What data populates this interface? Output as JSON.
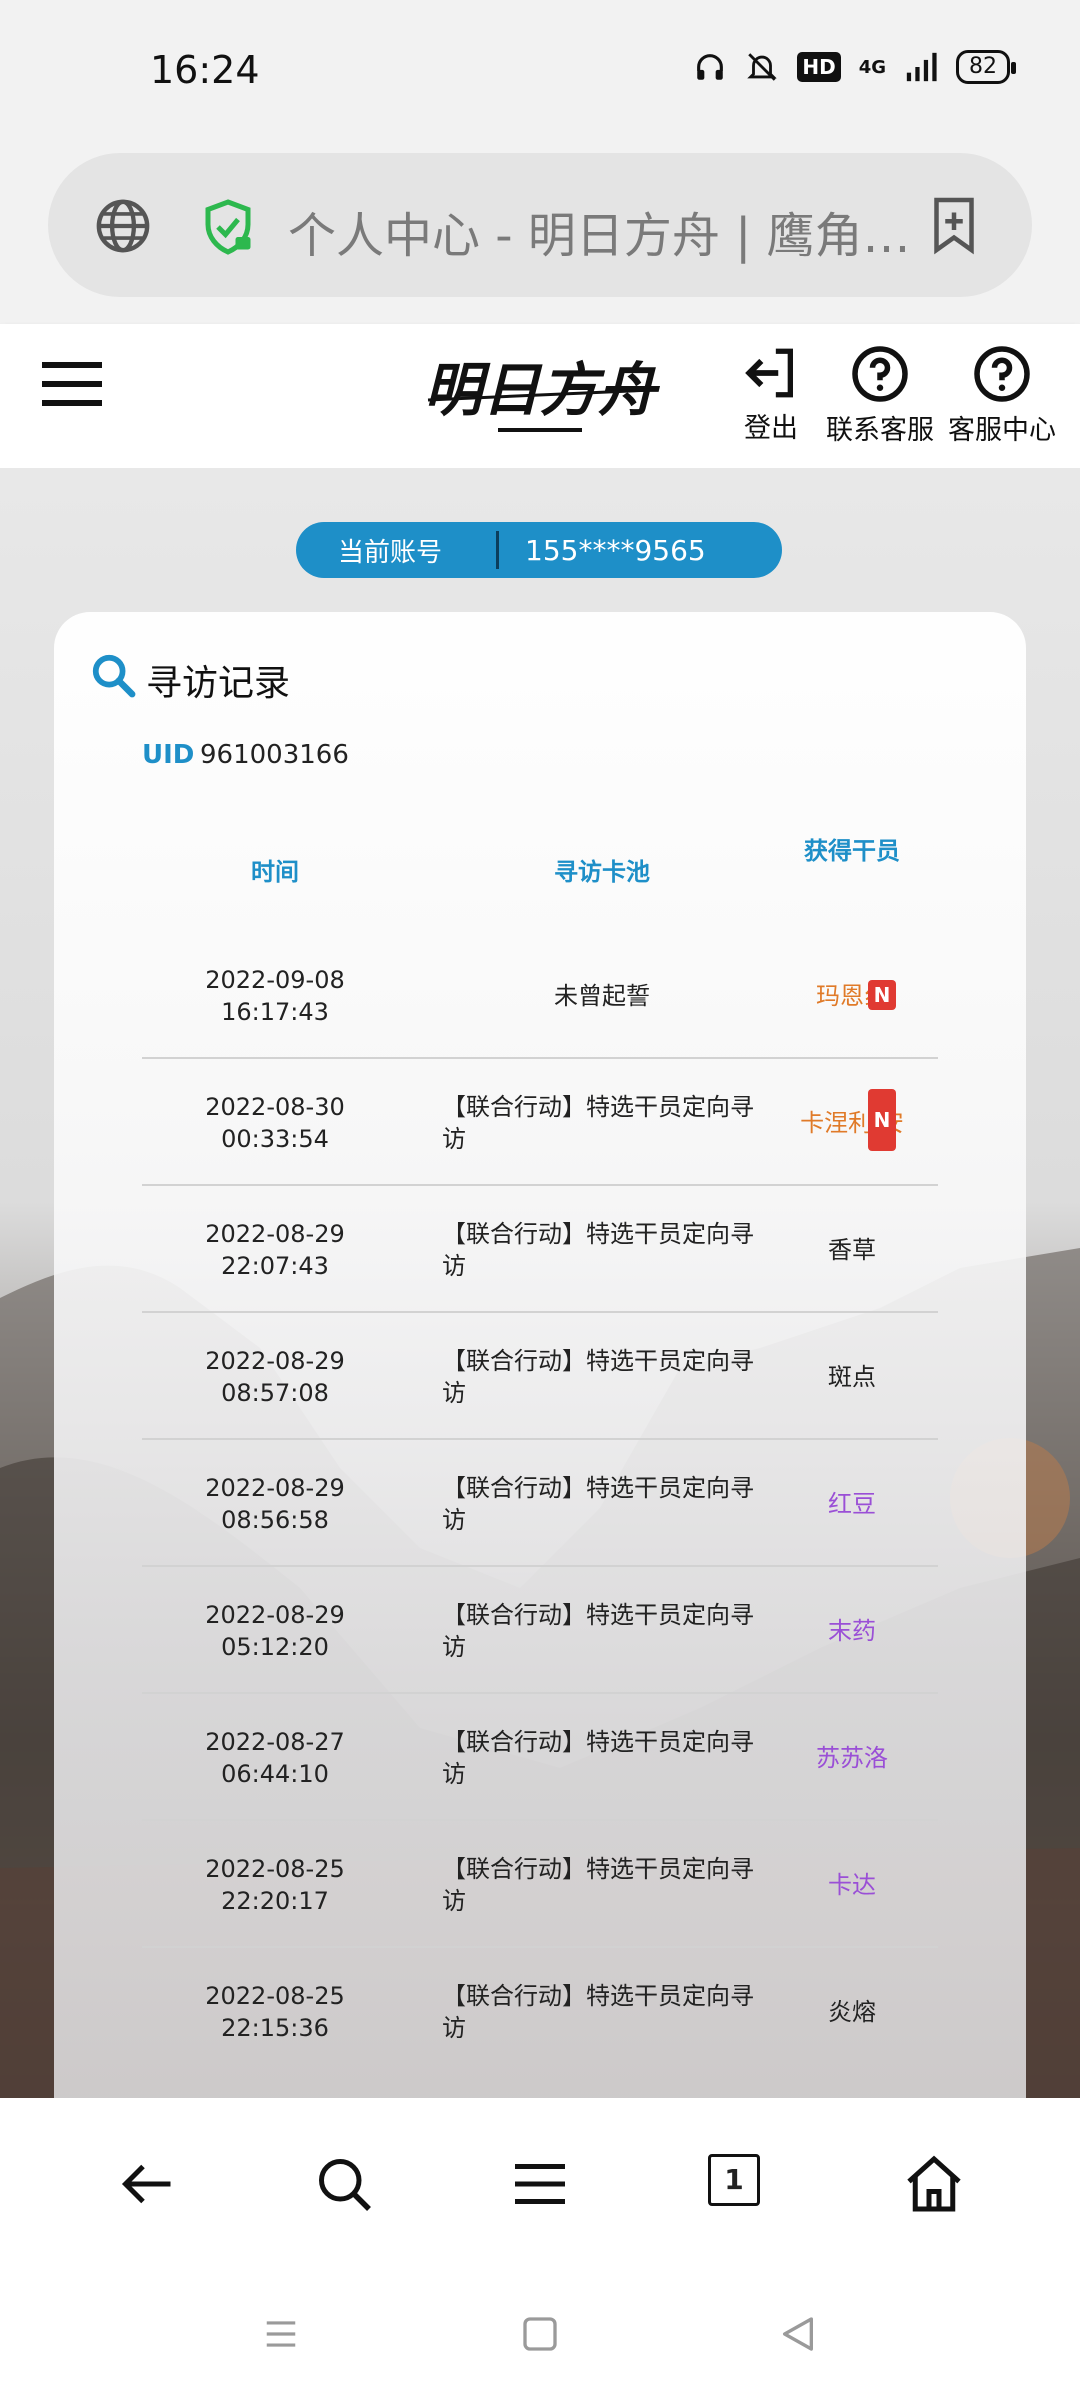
{
  "status_bar": {
    "time": "16:24",
    "network": "4G",
    "battery": "82"
  },
  "address_bar": {
    "title": "个人中心 - 明日方舟 | 鹰角…"
  },
  "header": {
    "logo_text": "明日方舟",
    "logout_label": "登出",
    "contact_label": "联系客服",
    "service_center_label": "客服中心"
  },
  "account": {
    "label": "当前账号",
    "value": "155****9565"
  },
  "records": {
    "heading": "寻访记录",
    "uid_label": "UID",
    "uid_value": "961003166",
    "columns": {
      "time": "时间",
      "pool": "寻访卡池",
      "operator": "获得干员"
    },
    "rows": [
      {
        "date": "2022-09-08",
        "time": "16:17:43",
        "pool": "未曾起誓",
        "operator": "玛恩纳",
        "operator_visible": "玛恩纟",
        "rarity_color": "#e07a28",
        "new": true,
        "new_label": "N"
      },
      {
        "date": "2022-08-30",
        "time": "00:33:54",
        "pool": "【联合行动】特选干员定向寻访",
        "operator": "卡涅利安",
        "operator_visible": "卡涅利 安",
        "rarity_color": "#e07a28",
        "new": true,
        "new_label": "N"
      },
      {
        "date": "2022-08-29",
        "time": "22:07:43",
        "pool": "【联合行动】特选干员定向寻访",
        "operator": "香草",
        "rarity_color": "#222222",
        "new": false
      },
      {
        "date": "2022-08-29",
        "time": "08:57:08",
        "pool": "【联合行动】特选干员定向寻访",
        "operator": "斑点",
        "rarity_color": "#222222",
        "new": false
      },
      {
        "date": "2022-08-29",
        "time": "08:56:58",
        "pool": "【联合行动】特选干员定向寻访",
        "operator": "红豆",
        "rarity_color": "#9a4fd6",
        "new": false
      },
      {
        "date": "2022-08-29",
        "time": "05:12:20",
        "pool": "【联合行动】特选干员定向寻访",
        "operator": "末药",
        "rarity_color": "#9a4fd6",
        "new": false
      },
      {
        "date": "2022-08-27",
        "time": "06:44:10",
        "pool": "【联合行动】特选干员定向寻访",
        "operator": "苏苏洛",
        "rarity_color": "#9a4fd6",
        "new": false
      },
      {
        "date": "2022-08-25",
        "time": "22:20:17",
        "pool": "【联合行动】特选干员定向寻访",
        "operator": "卡达",
        "rarity_color": "#9a4fd6",
        "new": false
      },
      {
        "date": "2022-08-25",
        "time": "22:15:36",
        "pool": "【联合行动】特选干员定向寻访",
        "operator": "炎熔",
        "rarity_color": "#222222",
        "new": false
      }
    ]
  },
  "colors": {
    "accent": "#1e8fc8",
    "six_star": "#e07a28",
    "four_star": "#9a4fd6",
    "new_badge": "#e03a32"
  },
  "toolbar_icons": [
    "back-icon",
    "search-icon",
    "menu-icon",
    "tabs-icon",
    "home-icon"
  ],
  "toolbar_tab_count": "1",
  "nav_icons": [
    "recent-apps-icon",
    "home-icon",
    "back-icon"
  ]
}
